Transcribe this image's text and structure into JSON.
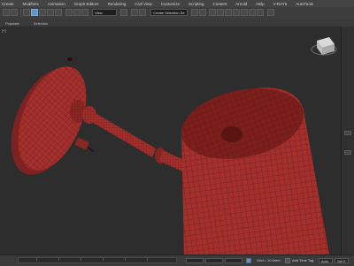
{
  "menu": [
    "Create",
    "Modifiers",
    "Animation",
    "Graph Editors",
    "Rendering",
    "Civil View",
    "Customize",
    "Scripting",
    "Content",
    "Arnold",
    "Help",
    "V-RAY5",
    "AutoTools"
  ],
  "toolbar": {
    "selection_set_placeholder": "Create Selection Se",
    "view_dropdown": "View"
  },
  "ribbon": [
    "Populate",
    "Selection"
  ],
  "viewport": {
    "label": "[+]",
    "model_color": "#a3302c",
    "wire_color": "#5e1412"
  },
  "status": {
    "grid_label": "Grid = 10.0mm",
    "add_time_tag": "Add Time Tag",
    "auto_key": "Auto",
    "set_key": "Set K"
  },
  "colors": {
    "accent_blue": "#5f93c9",
    "ui_dark": "#2b2b2b"
  }
}
